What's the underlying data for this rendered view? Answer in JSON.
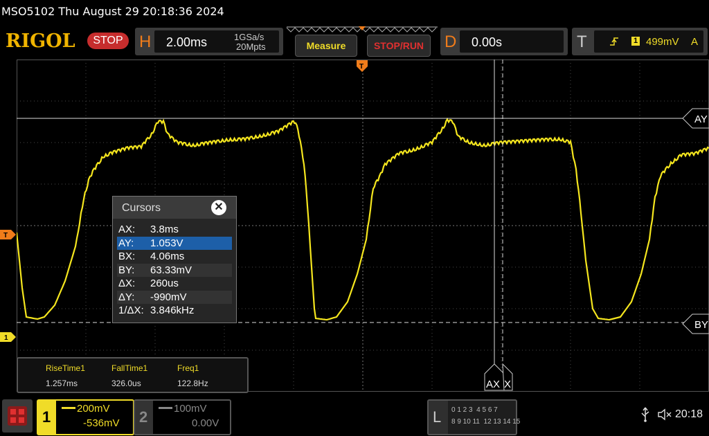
{
  "title_bar": {
    "text": "MSO5102  Thu August 29 20:18:36 2024"
  },
  "brand": {
    "logo": "RIGOL",
    "run_state": "STOP"
  },
  "horizontal": {
    "letter": "H",
    "timebase": "2.00ms",
    "sample_rate": "1GSa/s",
    "memory_depth": "20Mpts"
  },
  "buttons": {
    "measure": "Measure",
    "stop_run": "STOP/RUN"
  },
  "delay": {
    "letter": "D",
    "value": "0.00s"
  },
  "trigger": {
    "letter": "T",
    "slope_icon": "rising-edge-icon",
    "source": "1",
    "level": "499mV",
    "mode": "A"
  },
  "markers": {
    "trigger_left": "T",
    "ch1_ground": "1",
    "trigger_top": "T",
    "ay_label": "AY",
    "by_label": "BY",
    "ax_label": "AX",
    "bx_label": "X"
  },
  "cursors": {
    "title": "Cursors",
    "rows": [
      {
        "key": "AX:",
        "value": "3.8ms"
      },
      {
        "key": "AY:",
        "value": "1.053V"
      },
      {
        "key": "BX:",
        "value": "4.06ms"
      },
      {
        "key": "BY:",
        "value": "63.33mV"
      },
      {
        "key": "ΔX:",
        "value": "260us"
      },
      {
        "key": "ΔY:",
        "value": "-990mV"
      },
      {
        "key": "1/ΔX:",
        "value": "3.846kHz"
      }
    ],
    "selected_row": 1
  },
  "measurements": [
    {
      "label": "RiseTime1",
      "value": "1.257ms"
    },
    {
      "label": "FallTime1",
      "value": "326.0us"
    },
    {
      "label": "Freq1",
      "value": "122.8Hz"
    }
  ],
  "channel1": {
    "number": "1",
    "scale": "200mV",
    "offset": "-536mV",
    "color": "#f0dc28"
  },
  "channel2": {
    "number": "2",
    "scale": "100mV",
    "offset": "0.00V",
    "color": "#666666"
  },
  "logic": {
    "letter": "L",
    "row1": "0 1 2 3  4 5 6 7",
    "row2": "8 9 10 11  12 13 14 15"
  },
  "status": {
    "time": "20:18",
    "usb_icon": "usb-icon",
    "speaker_icon": "speaker-muted-icon"
  },
  "colors": {
    "trace": "#f5e61e",
    "accent": "#f07c1a",
    "grid": "#555555"
  }
}
